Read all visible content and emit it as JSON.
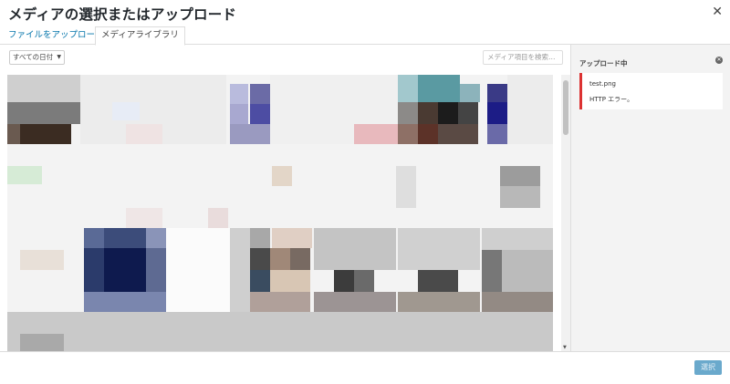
{
  "header": {
    "title": "メディアの選択またはアップロード",
    "close_icon": "close-icon"
  },
  "tabs": [
    {
      "label": "ファイルをアップロード"
    },
    {
      "label": "メディアライブラリ"
    }
  ],
  "toolbar": {
    "date_filter": "すべての日付",
    "search_placeholder": "メディア項目を検索…"
  },
  "sidebar": {
    "title": "アップロード中",
    "error": {
      "filename": "test.png",
      "message": "HTTP エラー。"
    }
  },
  "footer": {
    "select_label": "選択"
  },
  "colors": {
    "accent": "#0073aa",
    "error": "#dc3232",
    "button_disabled": "#6aa9cc"
  }
}
